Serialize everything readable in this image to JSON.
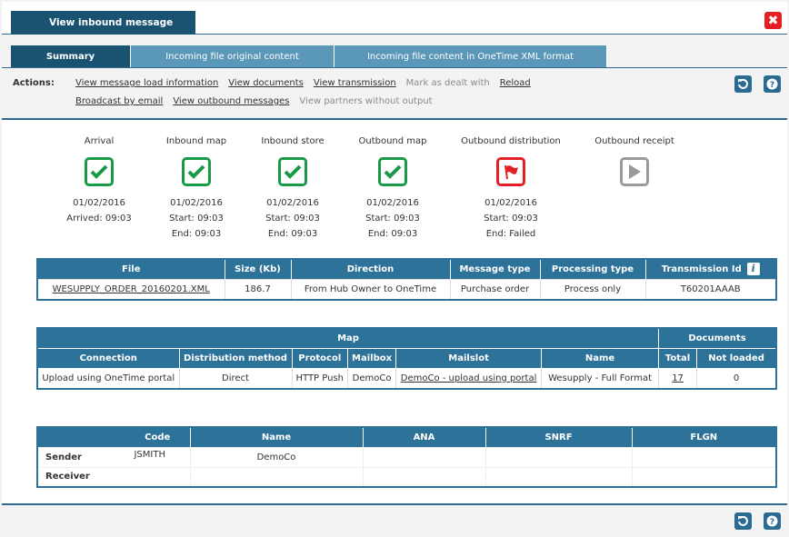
{
  "window": {
    "title": "View inbound message",
    "close_icon": "close-icon"
  },
  "tabs": [
    {
      "label": "Summary",
      "active": true
    },
    {
      "label": "Incoming file original content",
      "active": false
    },
    {
      "label": "Incoming file content in OneTime XML format",
      "active": false
    }
  ],
  "actions": {
    "label": "Actions:",
    "row1": [
      {
        "label": "View message load information",
        "enabled": true
      },
      {
        "label": "View documents",
        "enabled": true
      },
      {
        "label": "View transmission",
        "enabled": true
      },
      {
        "label": "Mark as dealt with",
        "enabled": false
      },
      {
        "label": "Reload",
        "enabled": true
      }
    ],
    "row2": [
      {
        "label": "Broadcast by email",
        "enabled": true
      },
      {
        "label": "View outbound messages",
        "enabled": true
      },
      {
        "label": "View partners without output",
        "enabled": false
      }
    ]
  },
  "toolbar": {
    "refresh_icon": "refresh-icon",
    "help_icon": "help-icon"
  },
  "steps": [
    {
      "name": "Arrival",
      "status": "success",
      "lines": [
        "01/02/2016",
        "Arrived: 09:03"
      ]
    },
    {
      "name": "Inbound map",
      "status": "success",
      "lines": [
        "01/02/2016",
        "Start: 09:03",
        "End: 09:03"
      ]
    },
    {
      "name": "Inbound store",
      "status": "success",
      "lines": [
        "01/02/2016",
        "Start: 09:03",
        "End: 09:03"
      ]
    },
    {
      "name": "Outbound map",
      "status": "success",
      "lines": [
        "01/02/2016",
        "Start: 09:03",
        "End: 09:03"
      ]
    },
    {
      "name": "Outbound distribution",
      "status": "failed",
      "lines": [
        "01/02/2016",
        "Start: 09:03",
        "End: Failed"
      ]
    },
    {
      "name": "Outbound receipt",
      "status": "pending",
      "lines": []
    }
  ],
  "file_table": {
    "headers": [
      "File",
      "Size (Kb)",
      "Direction",
      "Message type",
      "Processing type",
      "Transmission Id"
    ],
    "row": [
      "WESUPPLY_ORDER_20160201.XML",
      "186.7",
      "From Hub Owner to OneTime",
      "Purchase order",
      "Process only",
      "T60201AAAB"
    ]
  },
  "map_table": {
    "group_headers": [
      "Map",
      "Documents"
    ],
    "headers": [
      "Connection",
      "Distribution method",
      "Protocol",
      "Mailbox",
      "Mailslot",
      "Name",
      "Total",
      "Not loaded"
    ],
    "row": [
      "Upload using OneTime portal",
      "Direct",
      "HTTP Push",
      "DemoCo",
      "DemoCo - upload using portal",
      "Wesupply - Full Format",
      "17",
      "0"
    ]
  },
  "partner_table": {
    "headers": [
      "",
      "Code",
      "Name",
      "ANA",
      "SNRF",
      "FLGN"
    ],
    "rows": [
      [
        "Sender",
        "JSMITH",
        "DemoCo",
        "",
        "",
        ""
      ],
      [
        "Receiver",
        "",
        "",
        "",
        "",
        ""
      ]
    ]
  },
  "colors": {
    "primary_dark": "#1a5272",
    "tab_inactive": "#5b97b8",
    "table_header": "#2d7399",
    "success": "#1a9a47",
    "failure": "#e31e24",
    "pending": "#999999"
  }
}
